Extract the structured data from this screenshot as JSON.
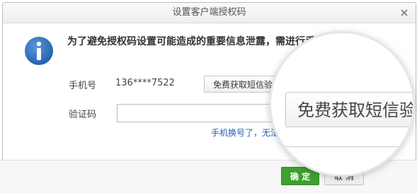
{
  "dialog": {
    "title": "设置客户端授权码",
    "message": "为了避免授权码设置可能造成的重要信息泄露，需进行手机短信验证",
    "phone_label": "手机号",
    "phone_value": "136****7522",
    "sms_button_label": "免费获取短信验证码",
    "code_label": "验证码",
    "code_value": "",
    "phone_changed_link": "手机换号了，无法接收短信？",
    "confirm_label": "确 定",
    "cancel_label": "取 消"
  },
  "magnifier": {
    "zoom_button_label": "免费获取短信验证码"
  },
  "colors": {
    "accent_green": "#3f9f2f",
    "info_blue": "#2b6cbc",
    "link_blue": "#1f5fb0"
  },
  "icons": {
    "close": "close-icon",
    "info": "info-icon"
  }
}
